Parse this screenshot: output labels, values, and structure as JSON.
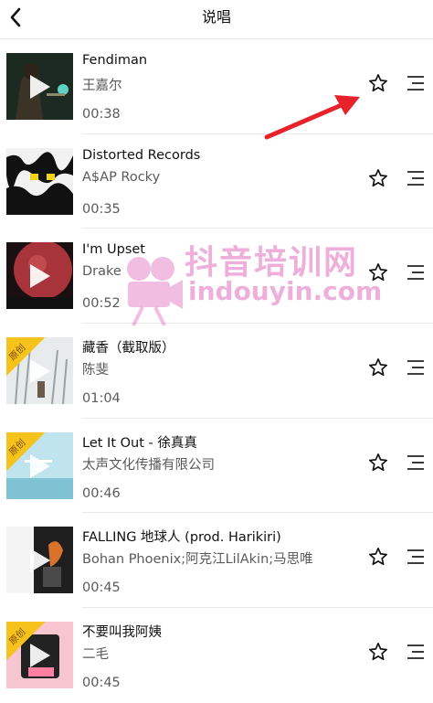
{
  "header": {
    "title": "说唱",
    "back_icon": "chevron-left-icon"
  },
  "songs": [
    {
      "title": "Fendiman",
      "artist": "王嘉尔",
      "duration": "00:38",
      "original": false
    },
    {
      "title": "Distorted Records",
      "artist": "A$AP Rocky",
      "duration": "00:35",
      "original": false
    },
    {
      "title": "I'm Upset",
      "artist": "Drake",
      "duration": "00:52",
      "original": false
    },
    {
      "title": "藏香（截取版）",
      "artist": "陈斐",
      "duration": "01:04",
      "original": true
    },
    {
      "title": "Let It Out - 徐真真",
      "artist": "太声文化传播有限公司",
      "duration": "00:46",
      "original": true
    },
    {
      "title": "FALLING 地球人 (prod. Harikiri)",
      "artist": "Bohan Phoenix;阿克江LilAkin;马思唯",
      "duration": "00:45",
      "original": false
    },
    {
      "title": "不要叫我阿姨",
      "artist": "二毛",
      "duration": "00:45",
      "original": true
    }
  ],
  "badge_label": "原创",
  "watermark": {
    "text_cn": "抖音培训网",
    "text_url": "indouyin.com"
  },
  "colors": {
    "badge": "#f5c31c",
    "arrow": "#e8222a",
    "watermark": "#e06ebe"
  }
}
